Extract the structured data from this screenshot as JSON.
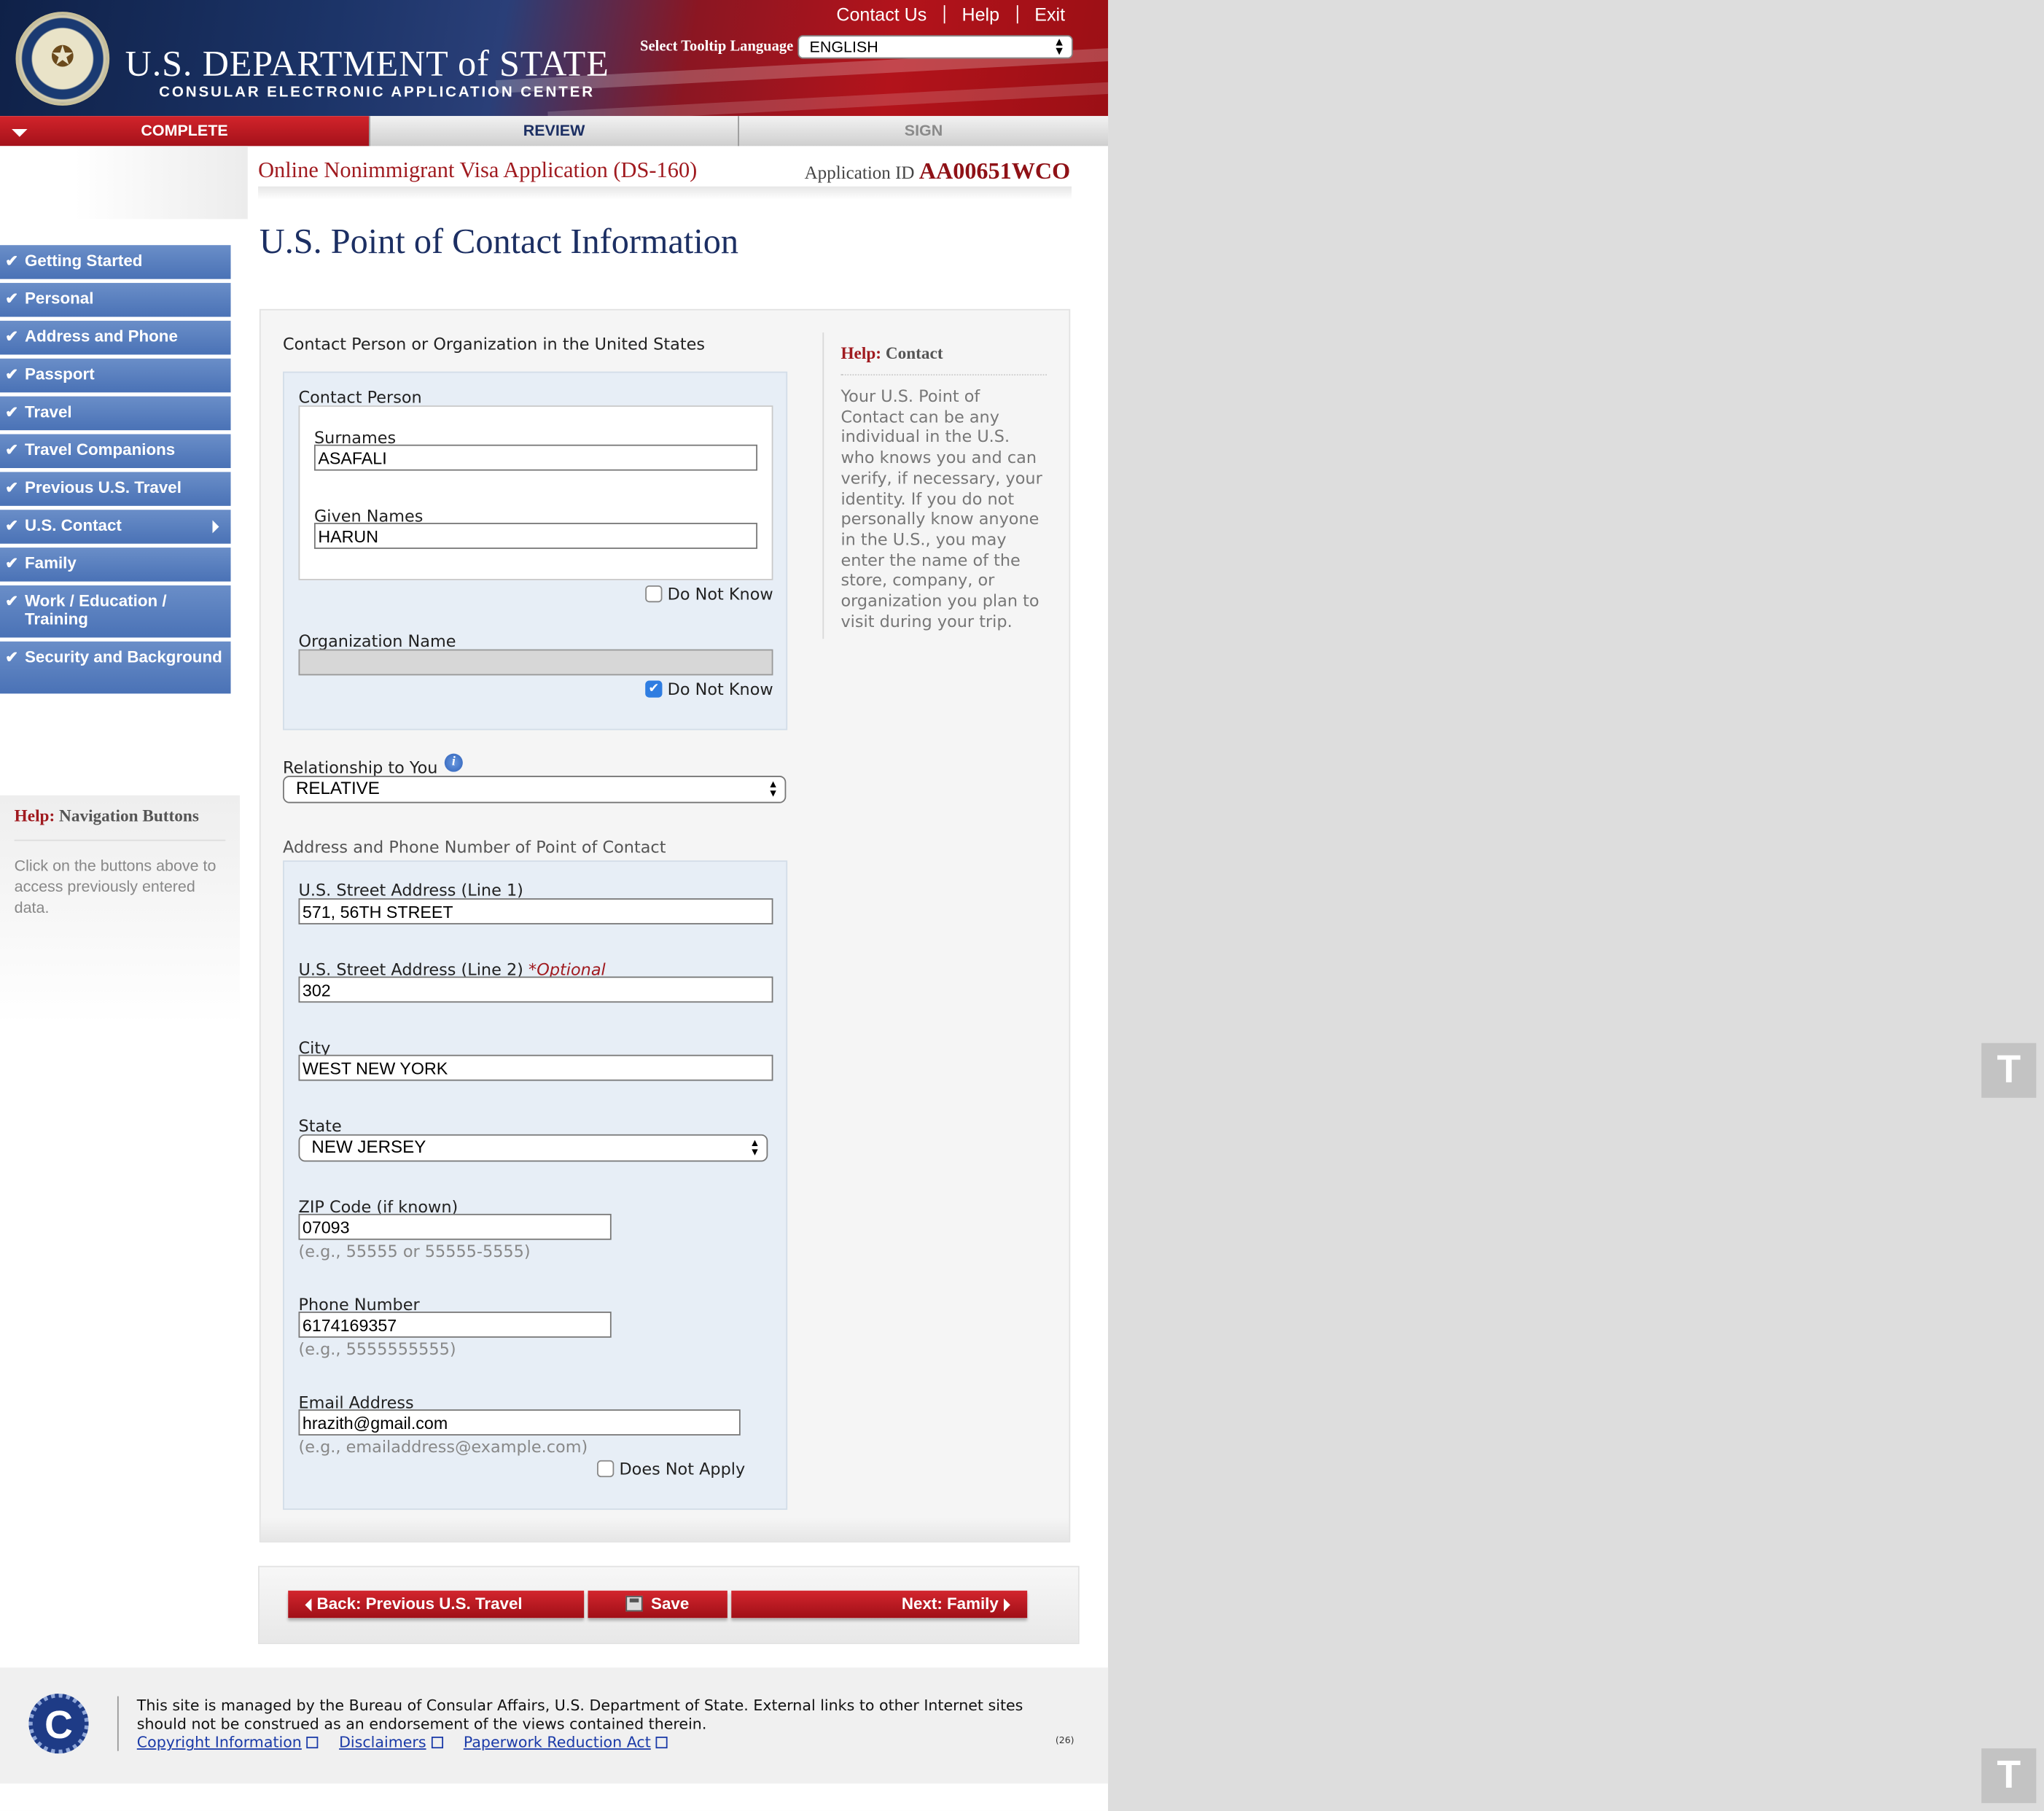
{
  "header": {
    "links": [
      "Contact Us",
      "Help",
      "Exit"
    ],
    "dept_title": "U.S. DEPARTMENT of STATE",
    "dept_subtitle": "CONSULAR ELECTRONIC APPLICATION CENTER",
    "tooltip_label": "Select Tooltip Language",
    "tooltip_language": "ENGLISH"
  },
  "steps": [
    {
      "label": "COMPLETE",
      "state": "active"
    },
    {
      "label": "REVIEW",
      "state": "pending"
    },
    {
      "label": "SIGN",
      "state": "disabled"
    }
  ],
  "application": {
    "title": "Online Nonimmigrant Visa Application (DS-160)",
    "id_label": "Application ID",
    "id_value": "AA00651WCO"
  },
  "sidebar": {
    "items": [
      {
        "label": "Getting Started",
        "completed": true
      },
      {
        "label": "Personal",
        "completed": true
      },
      {
        "label": "Address and Phone",
        "completed": true
      },
      {
        "label": "Passport",
        "completed": true
      },
      {
        "label": "Travel",
        "completed": true
      },
      {
        "label": "Travel Companions",
        "completed": true
      },
      {
        "label": "Previous U.S. Travel",
        "completed": true
      },
      {
        "label": "U.S. Contact",
        "completed": true,
        "current": true
      },
      {
        "label": "Family",
        "completed": true
      },
      {
        "label": "Work / Education / Training",
        "completed": true
      },
      {
        "label": "Security and Background",
        "completed": true
      }
    ],
    "help_prefix": "Help:",
    "help_title": "Navigation Buttons",
    "help_text": "Click on the buttons above to access previously entered data."
  },
  "page": {
    "heading": "U.S. Point of Contact Information"
  },
  "form": {
    "section_label": "Contact Person or Organization in the United States",
    "contact_person_label": "Contact Person",
    "surnames_label": "Surnames",
    "surnames_value": "ASAFALI",
    "given_names_label": "Given Names",
    "given_names_value": "HARUN",
    "contact_do_not_know_label": "Do Not Know",
    "contact_do_not_know_checked": false,
    "org_name_label": "Organization Name",
    "org_name_value": "",
    "org_do_not_know_label": "Do Not Know",
    "org_do_not_know_checked": true,
    "relationship_label": "Relationship to You",
    "relationship_value": "RELATIVE",
    "address_section_label": "Address and Phone Number of Point of Contact",
    "street1_label": "U.S. Street Address (Line 1)",
    "street1_value": "571, 56TH STREET",
    "street2_label": "U.S. Street Address (Line 2)",
    "street2_optional": "*Optional",
    "street2_value": "302",
    "city_label": "City",
    "city_value": "WEST NEW YORK",
    "state_label": "State",
    "state_value": "NEW JERSEY",
    "zip_label": "ZIP Code (if known)",
    "zip_value": "07093",
    "zip_hint": "(e.g., 55555 or 55555-5555)",
    "phone_label": "Phone Number",
    "phone_value": "6174169357",
    "phone_hint": "(e.g., 5555555555)",
    "email_label": "Email Address",
    "email_value": "hrazith@gmail.com",
    "email_hint": "(e.g., emailaddress@example.com)",
    "email_does_not_apply_label": "Does Not Apply",
    "email_does_not_apply_checked": false
  },
  "help": {
    "prefix": "Help:",
    "title": "Contact",
    "text": "Your U.S. Point of Contact can be any individual in the U.S. who knows you and can verify, if necessary, your identity. If you do not personally know anyone in the U.S., you may enter the name of the store, company, or organization you plan to visit during your trip."
  },
  "buttons": {
    "back": "Back: Previous U.S. Travel",
    "save": "Save",
    "next": "Next: Family"
  },
  "footer": {
    "logo_letter": "C",
    "text": "This site is managed by the Bureau of Consular Affairs, U.S. Department of State. External links to other Internet sites should not be construed as an endorsement of the views contained therein.",
    "links": [
      "Copyright Information",
      "Disclaimers",
      "Paperwork Reduction Act"
    ],
    "code": "(26)"
  },
  "widgets": {
    "t_label": "T"
  },
  "colors": {
    "brand_red": "#a01a1f",
    "navy": "#1c2f63",
    "nav_blue": "#4a72b6",
    "form_blue": "#e7eef6"
  }
}
